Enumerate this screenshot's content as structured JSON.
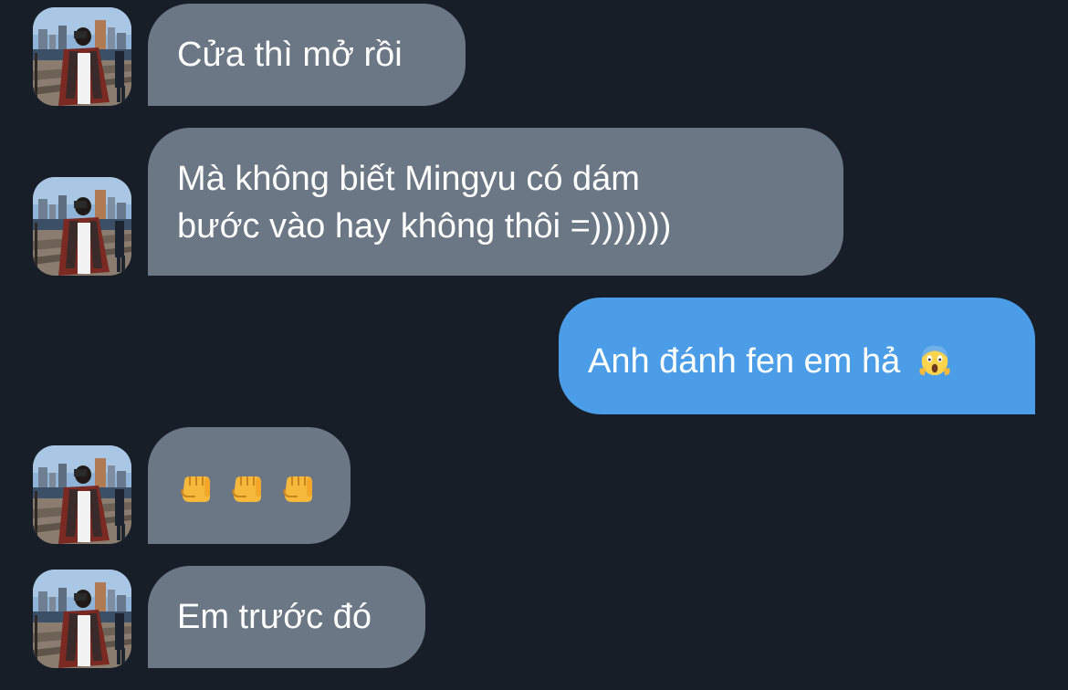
{
  "messages": [
    {
      "id": "m1",
      "direction": "incoming",
      "lines": [
        "Cửa thì mở rồi"
      ],
      "avatar": "contact-avatar"
    },
    {
      "id": "m2",
      "direction": "incoming",
      "lines": [
        "Mà không biết Mingyu có dám",
        "bước vào hay không thôi =)))))))"
      ],
      "avatar": "contact-avatar"
    },
    {
      "id": "m3",
      "direction": "outgoing",
      "lines": [
        "Anh đánh fen em hả"
      ],
      "emoji": "face-screaming-in-fear-icon"
    },
    {
      "id": "m4",
      "direction": "incoming",
      "lines": [],
      "emoji": [
        "oncoming-fist-icon",
        "oncoming-fist-icon",
        "oncoming-fist-icon"
      ],
      "avatar": "contact-avatar"
    },
    {
      "id": "m5",
      "direction": "incoming",
      "lines": [
        "Em trước đó"
      ],
      "avatar": "contact-avatar"
    }
  ],
  "colors": {
    "background": "#171e28",
    "incoming_bubble": "#6b7785",
    "outgoing_bubble": "#4b9de8",
    "text": "#ffffff"
  }
}
